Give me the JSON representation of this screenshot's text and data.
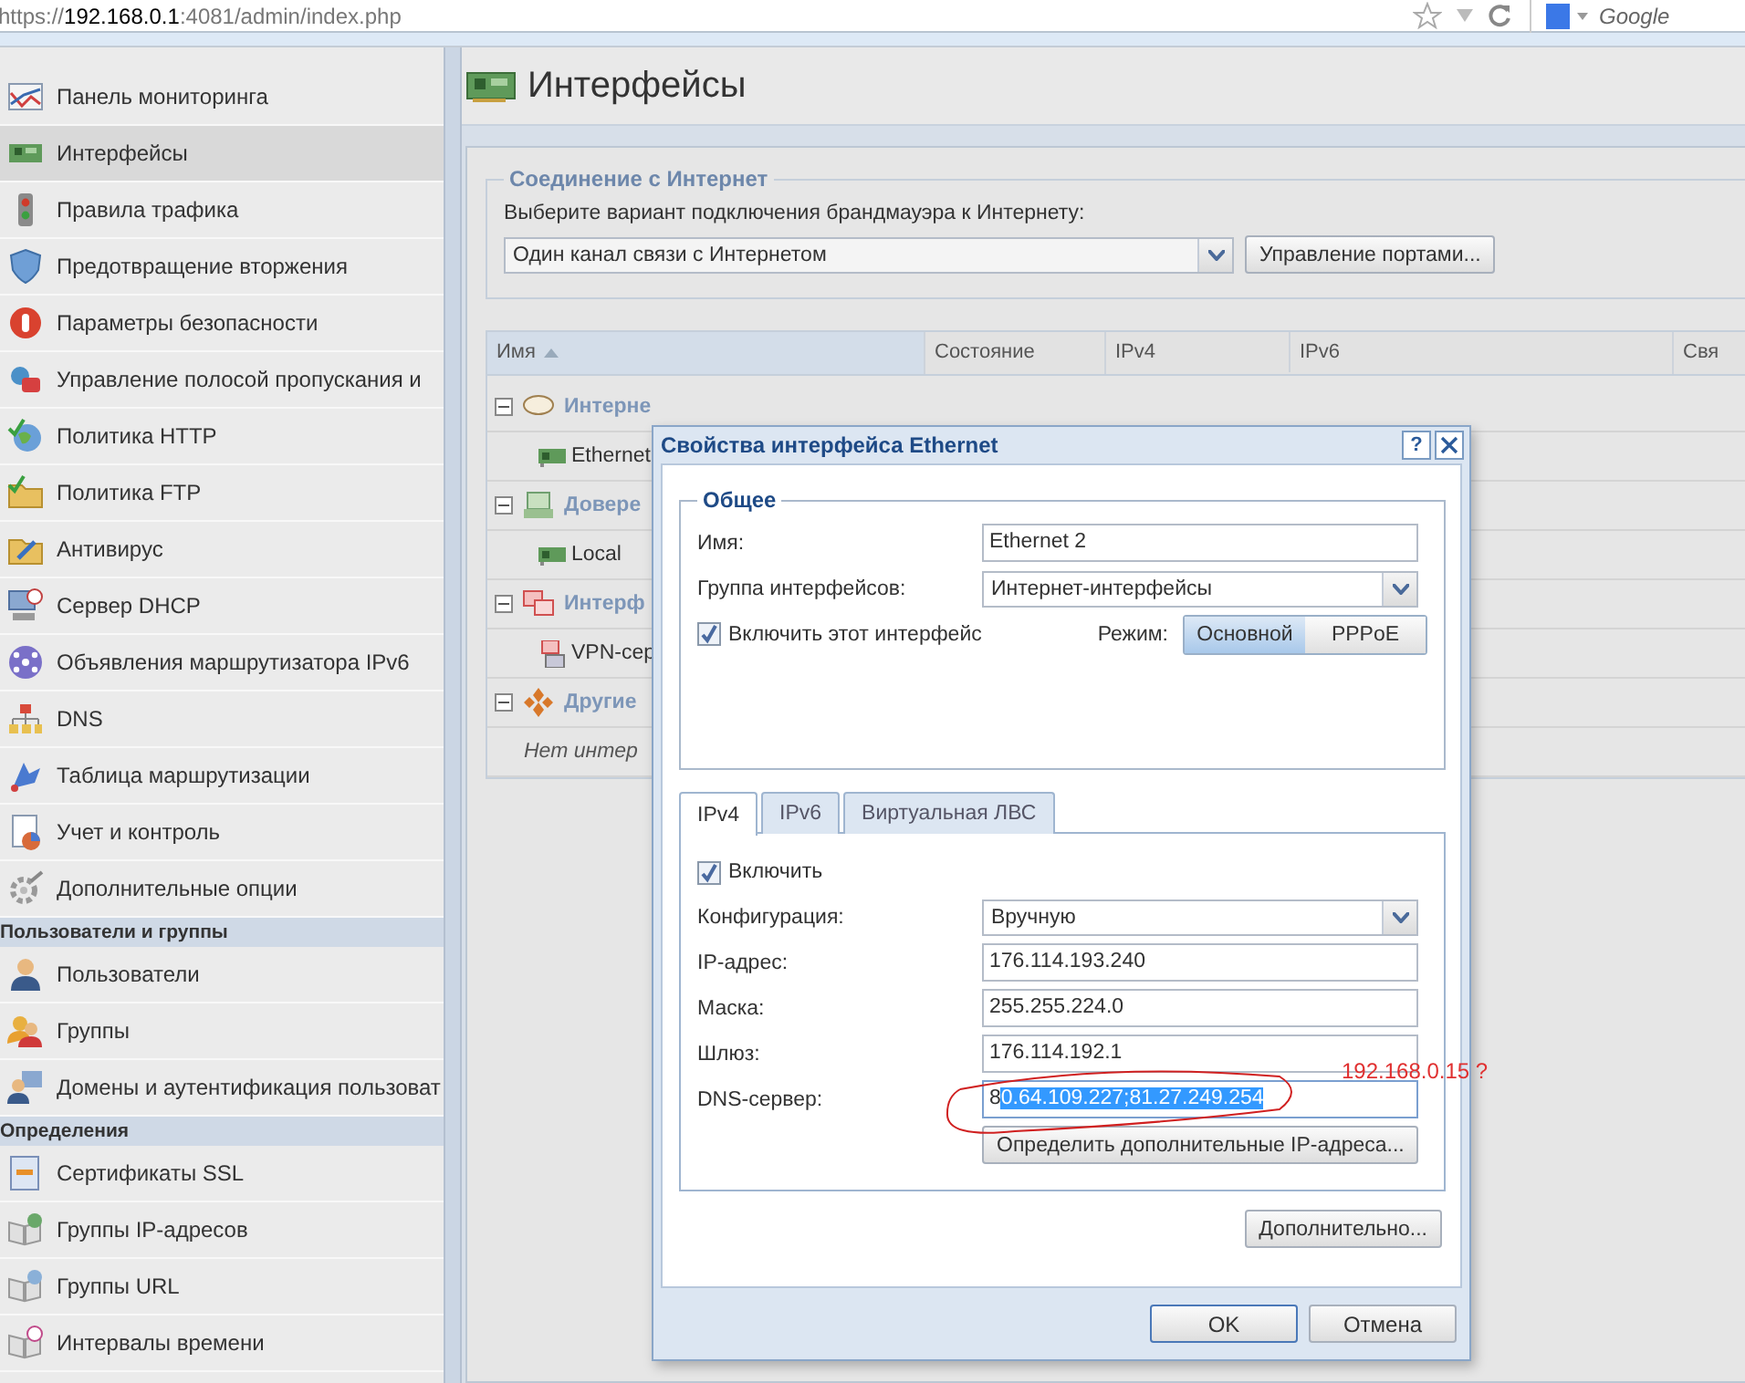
{
  "browser": {
    "url": {
      "scheme": "https://",
      "host": "192.168.0.1",
      "rest": ":4081/admin/index.php"
    },
    "search": {
      "placeholder": "Google"
    }
  },
  "sidebar": {
    "items": [
      {
        "kind": "item",
        "label": "Панель мониторинга",
        "selected": false
      },
      {
        "kind": "item",
        "label": "Интерфейсы",
        "selected": true
      },
      {
        "kind": "item",
        "label": "Правила трафика",
        "selected": false
      },
      {
        "kind": "item",
        "label": "Предотвращение вторжения",
        "selected": false
      },
      {
        "kind": "item",
        "label": "Параметры безопасности",
        "selected": false
      },
      {
        "kind": "item",
        "label": "Управление полосой пропускания и",
        "selected": false
      },
      {
        "kind": "item",
        "label": "Политика HTTP",
        "selected": false
      },
      {
        "kind": "item",
        "label": "Политика FTP",
        "selected": false
      },
      {
        "kind": "item",
        "label": "Антивирус",
        "selected": false
      },
      {
        "kind": "item",
        "label": "Сервер DHCP",
        "selected": false
      },
      {
        "kind": "item",
        "label": "Объявления маршрутизатора IPv6",
        "selected": false
      },
      {
        "kind": "item",
        "label": "DNS",
        "selected": false
      },
      {
        "kind": "item",
        "label": "Таблица маршрутизации",
        "selected": false
      },
      {
        "kind": "item",
        "label": "Учет и контроль",
        "selected": false
      },
      {
        "kind": "item",
        "label": "Дополнительные опции",
        "selected": false
      },
      {
        "kind": "header",
        "label": "Пользователи и группы"
      },
      {
        "kind": "item",
        "label": "Пользователи",
        "selected": false
      },
      {
        "kind": "item",
        "label": "Группы",
        "selected": false
      },
      {
        "kind": "item",
        "label": "Домены и аутентификация пользоват",
        "selected": false
      },
      {
        "kind": "header",
        "label": "Определения"
      },
      {
        "kind": "item",
        "label": "Сертификаты SSL",
        "selected": false
      },
      {
        "kind": "item",
        "label": "Группы IP-адресов",
        "selected": false
      },
      {
        "kind": "item",
        "label": "Группы URL",
        "selected": false
      },
      {
        "kind": "item",
        "label": "Интервалы времени",
        "selected": false
      }
    ]
  },
  "page": {
    "title": "Интерфейсы"
  },
  "connection": {
    "legend": "Соединение с Интернет",
    "prompt": "Выберите вариант подключения брандмауэра к Интернету:",
    "select": "Один канал связи с Интернетом",
    "button": "Управление портами..."
  },
  "table": {
    "columns": [
      {
        "label": "Имя",
        "sorted": true
      },
      {
        "label": "Состояние",
        "sorted": false
      },
      {
        "label": "IPv4",
        "sorted": false
      },
      {
        "label": "IPv6",
        "sorted": false
      },
      {
        "label": "Свя",
        "sorted": false
      }
    ],
    "groups": [
      {
        "name": "Интерне",
        "expanded": true,
        "rows": [
          {
            "kind": "interface",
            "name": "Ethernet"
          }
        ]
      },
      {
        "name": "Довере",
        "expanded": true,
        "rows": [
          {
            "kind": "interface",
            "name": "Local"
          }
        ]
      },
      {
        "name": "Интерф",
        "expanded": true,
        "rows": [
          {
            "kind": "vpn",
            "name": "VPN-сер"
          }
        ]
      },
      {
        "name": "Другие",
        "expanded": true,
        "rows": [
          {
            "kind": "empty",
            "name": "Нет интер"
          }
        ]
      }
    ]
  },
  "dialog": {
    "title": "Свойства интерфейса Ethernet",
    "help": "?",
    "general": {
      "legend": "Общее",
      "name_label": "Имя:",
      "name_value": "Ethernet 2",
      "group_label": "Группа интерфейсов:",
      "group_value": "Интернет-интерфейсы",
      "enable": {
        "label": "Включить этот интерфейс",
        "checked": true
      },
      "mode_label": "Режим:",
      "modes": [
        {
          "label": "Основной",
          "selected": true
        },
        {
          "label": "PPPoE",
          "selected": false
        }
      ]
    },
    "tabs": [
      {
        "label": "IPv4",
        "selected": true
      },
      {
        "label": "IPv6",
        "selected": false
      },
      {
        "label": "Виртуальная ЛВС",
        "selected": false
      }
    ],
    "ipv4": {
      "enable": {
        "label": "Включить",
        "checked": true
      },
      "fields": [
        {
          "kind": "select",
          "label": "Конфигурация:",
          "value": "Вручную"
        },
        {
          "kind": "text",
          "label": "IP-адрес:",
          "value": "176.114.193.240"
        },
        {
          "kind": "text",
          "label": "Маска:",
          "value": "255.255.224.0"
        },
        {
          "kind": "text",
          "label": "Шлюз:",
          "value": "176.114.192.1"
        },
        {
          "kind": "selection",
          "label": "DNS-сервер:",
          "value": "8",
          "selected_text": "0.64.109.227;81.27.249.254"
        }
      ],
      "extra_button": "Определить дополнительные IP-адреса..."
    },
    "advanced_button": "Дополнительно...",
    "buttons": [
      {
        "label": "OK",
        "default": true
      },
      {
        "label": "Отмена",
        "default": false
      }
    ]
  },
  "annotation": {
    "text": "192.168.0.15 ?"
  }
}
